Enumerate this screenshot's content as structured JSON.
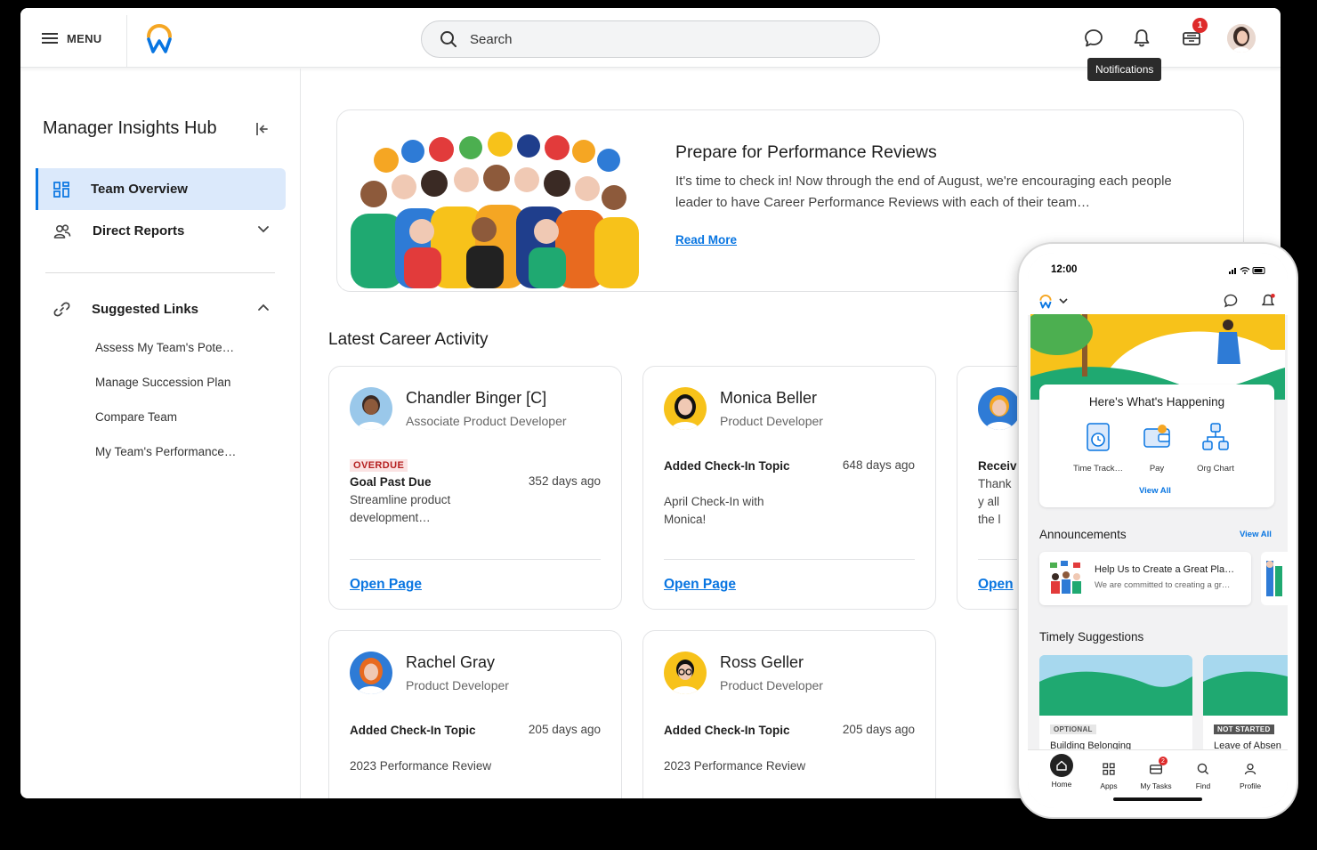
{
  "topbar": {
    "menu_label": "MENU",
    "search_placeholder": "Search",
    "tasks_badge": "1",
    "tooltip": "Notifications"
  },
  "sidebar": {
    "title": "Manager Insights Hub",
    "items": [
      {
        "label": "Team Overview",
        "icon": "grid-icon"
      },
      {
        "label": "Direct Reports",
        "icon": "people-icon"
      },
      {
        "label": "Suggested Links",
        "icon": "link-icon"
      }
    ],
    "links": [
      "Assess My Team's Pote…",
      "Manage Succession Plan",
      "Compare Team",
      "My Team's Performance…"
    ]
  },
  "hero": {
    "title": "Prepare for Performance Reviews",
    "body": "It's time to check in! Now through the end of August, we're encouraging each people leader to have Career Performance Reviews with each of their team…",
    "link": "Read More"
  },
  "activity": {
    "title": "Latest Career Activity",
    "cards": [
      {
        "name": "Chandler Binger [C]",
        "role": "Associate Product Developer",
        "tag": "OVERDUE",
        "action": "Goal Past Due",
        "when": "352 days ago",
        "desc": "Streamline product development…",
        "link": "Open Page"
      },
      {
        "name": "Monica Beller",
        "role": "Product Developer",
        "action": "Added Check-In Topic",
        "when": "648 days ago",
        "desc": "April Check-In with Monica!",
        "link": "Open Page"
      },
      {
        "name": "",
        "role": "",
        "action": "Receiv",
        "desc": "Thank y all the l",
        "link": "Open"
      },
      {
        "name": "Rachel Gray",
        "role": "Product Developer",
        "action": "Added Check-In Topic",
        "when": "205 days ago",
        "desc": "2023 Performance Review"
      },
      {
        "name": "Ross Geller",
        "role": "Product Developer",
        "action": "Added Check-In Topic",
        "when": "205 days ago",
        "desc": "2023 Performance Review"
      }
    ]
  },
  "phone": {
    "time": "12:00",
    "happening_title": "Here's What's Happening",
    "apps": [
      "Time Track…",
      "Pay",
      "Org Chart"
    ],
    "view_all": "View All",
    "announcements_title": "Announcements",
    "announcement": {
      "title": "Help Us to Create a Great Pla…",
      "body": "We are committed to creating a gr…"
    },
    "suggestions_title": "Timely Suggestions",
    "suggestions": [
      {
        "tag": "OPTIONAL",
        "title": "Building Belonging"
      },
      {
        "tag": "NOT STARTED",
        "title": "Leave of Absen"
      }
    ],
    "nav": [
      "Home",
      "Apps",
      "My Tasks",
      "Find",
      "Profile"
    ],
    "nav_badge": "2"
  },
  "colors": {
    "accent": "#0875e1",
    "active_bg": "#dbe9fb",
    "badge": "#de2a2a",
    "overdue": "#b52020"
  }
}
